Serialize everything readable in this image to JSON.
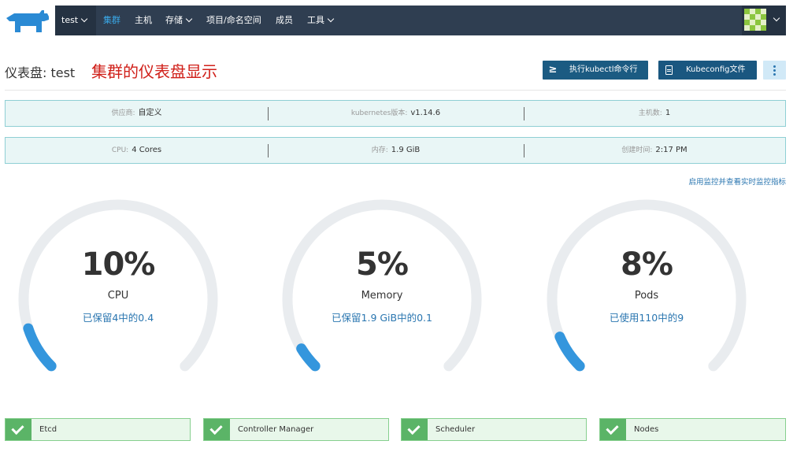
{
  "nav": {
    "cluster": "test",
    "items": [
      "集群",
      "主机",
      "存储",
      "项目/命名空间",
      "成员",
      "工具"
    ],
    "active_index": 0
  },
  "header": {
    "title": "仪表盘: test",
    "annotation": "集群的仪表盘显示",
    "kubectl_icon": "≥",
    "kubectl_label": "执行kubectl命令行",
    "kubeconfig_label": "Kubeconfig文件"
  },
  "info": {
    "provider_label": "供应商:",
    "provider": "自定义",
    "k8s_label": "kubernetes版本:",
    "k8s_version": "v1.14.6",
    "hosts_label": "主机数:",
    "hosts": "1",
    "cpu_label": "CPU:",
    "cpu": "4 Cores",
    "mem_label": "内存:",
    "mem": "1.9 GiB",
    "created_label": "创建时间:",
    "created": "2:17 PM"
  },
  "monitor_link": "启用监控并查看实时监控指标",
  "gauges": [
    {
      "percent_text": "10%",
      "value": 0.1,
      "name": "CPU",
      "sub": "已保留4中的0.4"
    },
    {
      "percent_text": "5%",
      "value": 0.05,
      "name": "Memory",
      "sub": "已保留1.9 GiB中的0.1"
    },
    {
      "percent_text": "8%",
      "value": 0.08,
      "name": "Pods",
      "sub": "已使用110中的9"
    }
  ],
  "health": [
    "Etcd",
    "Controller Manager",
    "Scheduler",
    "Nodes"
  ],
  "colors": {
    "nav_bg": "#2f3e51",
    "accent": "#3aa9e9",
    "gauge_track": "#e9ecef",
    "gauge_fill": "#3496dd",
    "health_green": "#5bb467"
  }
}
